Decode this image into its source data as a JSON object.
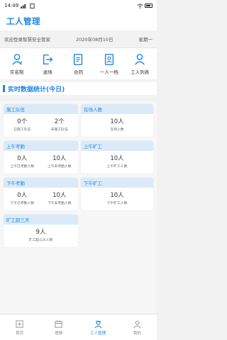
{
  "status": {
    "time": "14:49"
  },
  "header": {
    "title": "工人管理"
  },
  "welcome": {
    "text": "欢迎登录智慧安全管家",
    "date": "2020年08月10日",
    "weekday": "星期一"
  },
  "menu": [
    {
      "label": "实名制",
      "icon": "person-id-icon"
    },
    {
      "label": "退场",
      "icon": "exit-icon"
    },
    {
      "label": "合同",
      "icon": "contract-icon"
    },
    {
      "label": "一人一档",
      "icon": "profile-doc-icon"
    },
    {
      "label": "工人列表",
      "icon": "worker-list-icon"
    }
  ],
  "section": {
    "title": "实时数据统计(今日)"
  },
  "cards": {
    "team": {
      "title": "施工队伍",
      "stats": [
        {
          "value": "0个",
          "label": "已施工队伍"
        },
        {
          "value": "2个",
          "label": "未施工队伍"
        }
      ]
    },
    "onsite": {
      "title": "在场人数",
      "stats": [
        {
          "value": "10人",
          "label": "在场人数"
        }
      ]
    },
    "am_attend": {
      "title": "上午考勤",
      "stats": [
        {
          "value": "0人",
          "label": "上午已考勤人数"
        },
        {
          "value": "10人",
          "label": "上午未考勤人数"
        }
      ]
    },
    "am_absent": {
      "title": "上午旷工",
      "stats": [
        {
          "value": "10人",
          "label": "上午旷工人数"
        }
      ]
    },
    "pm_attend": {
      "title": "下午考勤",
      "stats": [
        {
          "value": "0人",
          "label": "下午已考勤人数"
        },
        {
          "value": "10人",
          "label": "下午未考勤人数"
        }
      ]
    },
    "pm_absent": {
      "title": "下午旷工",
      "stats": [
        {
          "value": "10人",
          "label": "下午旷工人数"
        }
      ]
    },
    "over3": {
      "title": "旷工超三天",
      "stats": [
        {
          "value": "9人",
          "label": "旷工超三天人数"
        }
      ]
    }
  },
  "tabs": [
    {
      "label": "首页",
      "icon": "home-icon",
      "active": false
    },
    {
      "label": "督察",
      "icon": "calendar-icon",
      "active": false
    },
    {
      "label": "工人管理",
      "icon": "worker-icon",
      "active": true
    },
    {
      "label": "我的",
      "icon": "user-icon",
      "active": false
    }
  ],
  "colors": {
    "accent": "#1e88e5",
    "card_head": "#dbeaf8"
  }
}
